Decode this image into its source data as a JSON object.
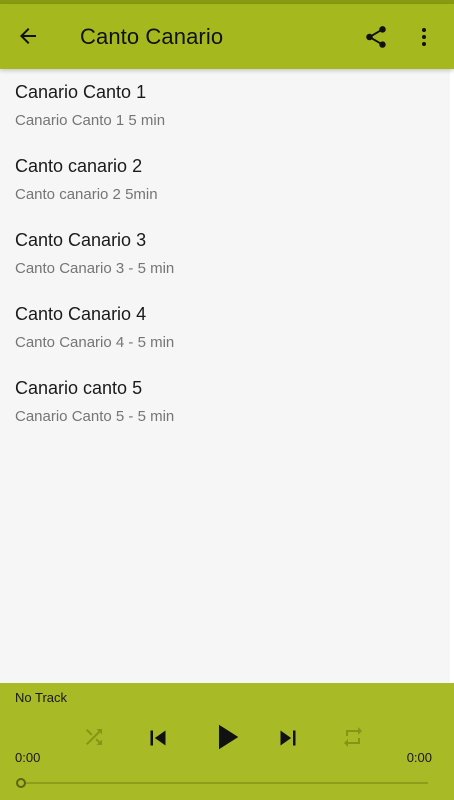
{
  "appbar": {
    "title": "Canto Canario",
    "back_icon": "arrow-left-icon",
    "share_icon": "share-icon",
    "more_icon": "more-vertical-icon"
  },
  "tracks": [
    {
      "title": "Canario Canto 1",
      "subtitle": "Canario Canto 1 5 min"
    },
    {
      "title": "Canto canario 2",
      "subtitle": "Canto canario 2 5min"
    },
    {
      "title": "Canto Canario 3",
      "subtitle": "Canto Canario 3 - 5 min"
    },
    {
      "title": "Canto Canario 4",
      "subtitle": "Canto Canario 4 - 5 min"
    },
    {
      "title": "Canario canto 5",
      "subtitle": "Canario Canto 5 - 5 min"
    }
  ],
  "player": {
    "track_label": "No Track",
    "elapsed": "0:00",
    "duration": "0:00",
    "progress": 0
  },
  "colors": {
    "appbar": "#a5b91e",
    "status_strip": "#879a12",
    "player": "#a8ba26",
    "background": "#f6f6f6"
  }
}
